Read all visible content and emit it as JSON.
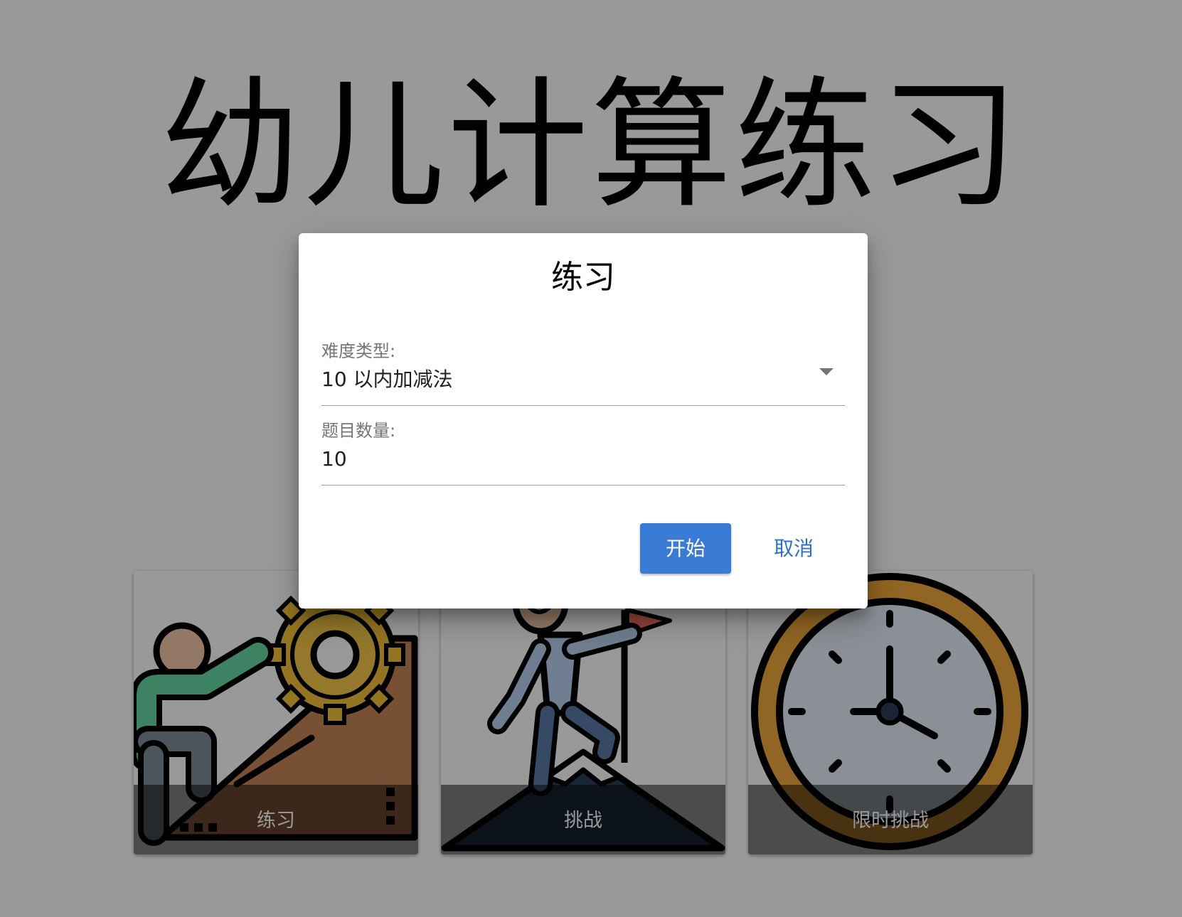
{
  "app": {
    "title": "幼儿计算练习"
  },
  "cards": [
    {
      "label": "练习",
      "icon": "climber-gear-icon"
    },
    {
      "label": "挑战",
      "icon": "mountain-summit-flag-icon"
    },
    {
      "label": "限时挑战",
      "icon": "clock-icon"
    }
  ],
  "dialog": {
    "title": "练习",
    "difficulty": {
      "label": "难度类型:",
      "value": "10 以内加减法"
    },
    "count": {
      "label": "题目数量:",
      "value": "10"
    },
    "start_label": "开始",
    "cancel_label": "取消"
  },
  "colors": {
    "accent": "#3a7bd5",
    "link": "#2d6fcb",
    "scrim": "rgba(0,0,0,0.4)"
  }
}
